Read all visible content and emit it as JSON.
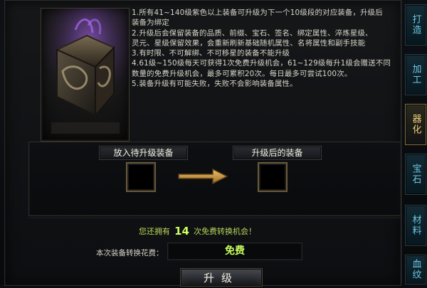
{
  "rules": {
    "lines": [
      "1.所有41~140级紫色以上装备可升级为下一个10级段的对应装备，升级后",
      "装备为绑定",
      "2.升级后会保留装备的品质、前缀、宝石、签名、绑定属性、淬炼星级、",
      "灵元、星级保留效果，会重新刷新基础随机属性、名将属性和副手技能",
      "3.有时限、不可解绑、不可移星的装备不能升级",
      "4.61级~150级每天可获得1次免费升级机会，61~129级每升1级会赠送不同",
      "数量的免费升级机会，最多可累积20次。每日最多可尝试100次。",
      "5.装备升级有可能失败，失败不会影响装备属性。"
    ]
  },
  "upgrade": {
    "left_label": "放入待升级装备",
    "right_label": "升级后的装备",
    "free_prefix": "您还拥有",
    "free_count": "14",
    "free_suffix": "次免费转换机会！",
    "cost_label": "本次装备转换花费：",
    "cost_value": "免费",
    "button_label": "升级"
  },
  "tabs": [
    {
      "label": "打造"
    },
    {
      "label": "加工"
    },
    {
      "label": "器化"
    },
    {
      "label": "宝石"
    },
    {
      "label": "材料"
    },
    {
      "label": "血纹"
    }
  ],
  "colors": {
    "accent_green": "#c9ff5e",
    "tab_blue": "#6fc7e6",
    "tab_active_gold": "#f1d07a"
  }
}
